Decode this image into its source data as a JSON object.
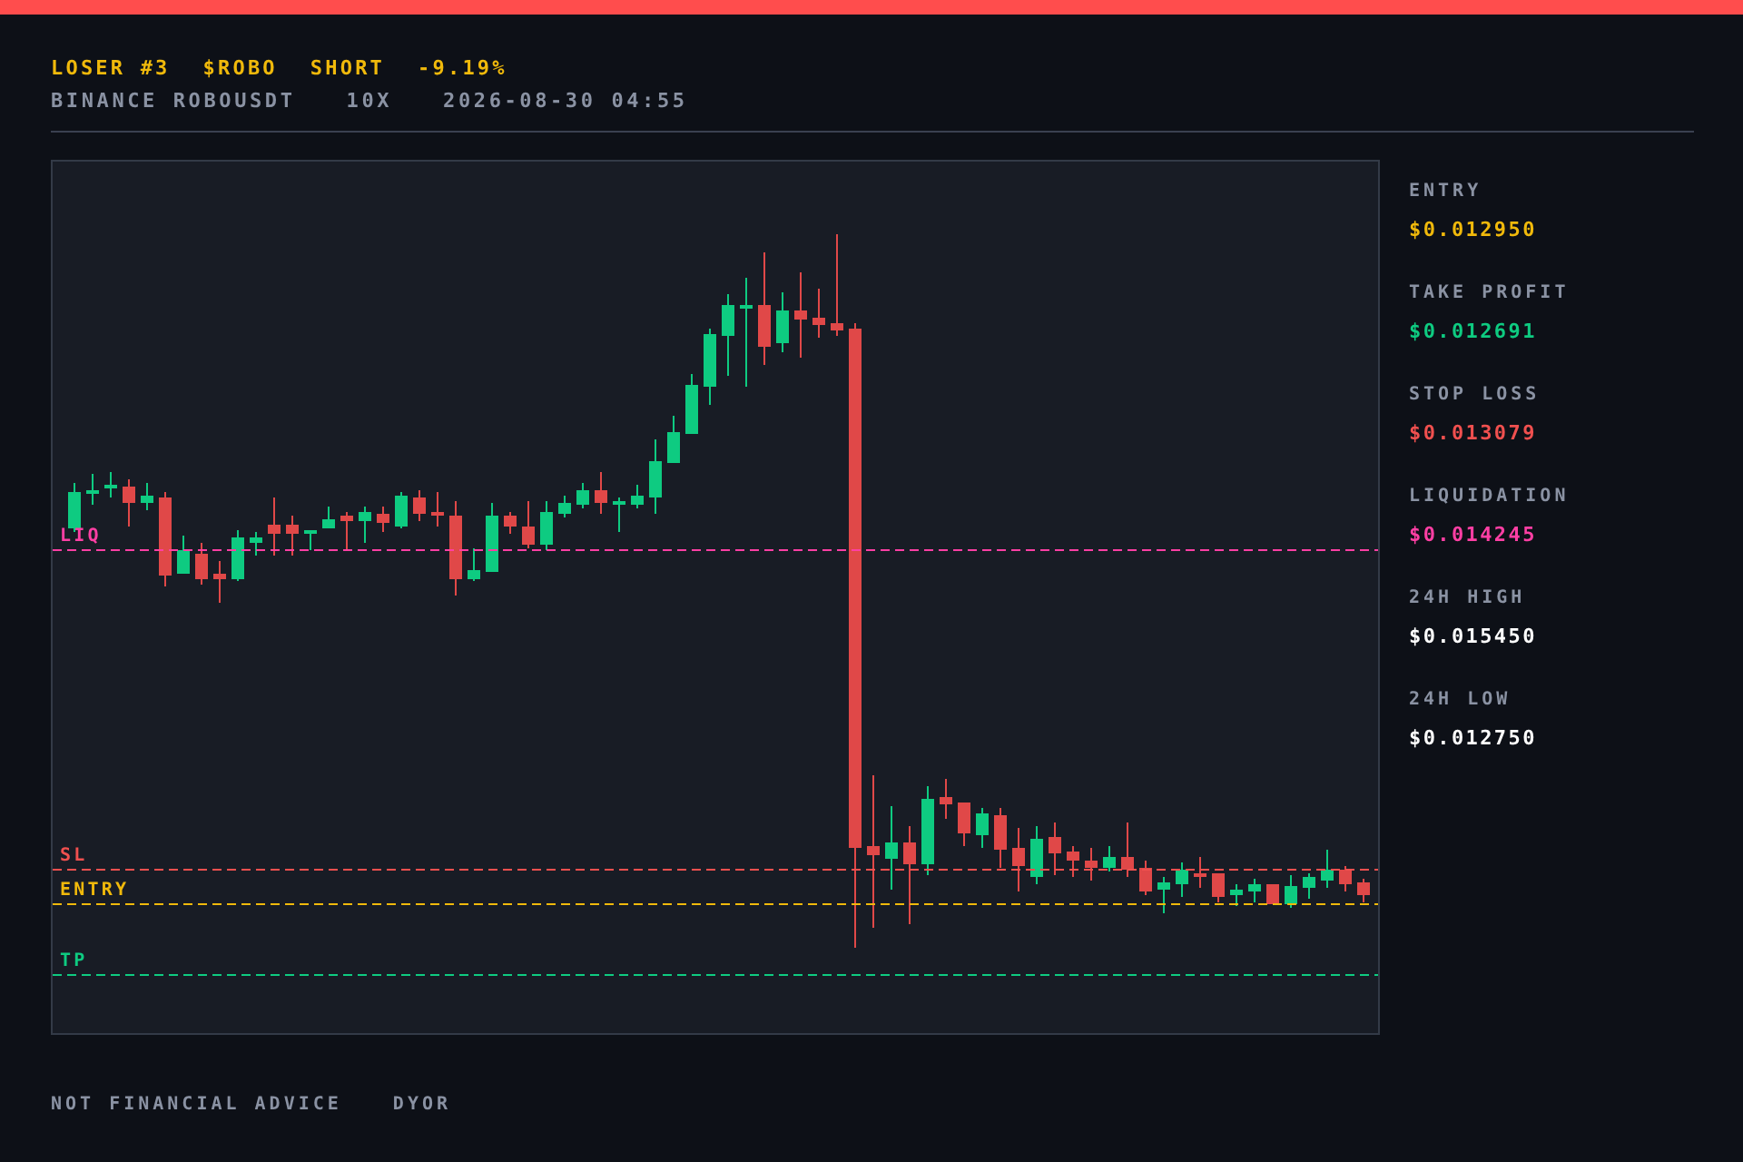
{
  "header": {
    "title_parts": [
      {
        "text": "LOSER #3"
      },
      {
        "text": "$ROBO"
      },
      {
        "text": "SHORT"
      },
      {
        "text": "-9.19%"
      }
    ],
    "subtitle_parts": [
      "BINANCE ROBOUSDT",
      "10X",
      "2026-08-30 04:55"
    ]
  },
  "chart": {
    "levels": [
      {
        "label": "LIQ",
        "color": "#ff3fa4"
      },
      {
        "label": "SL",
        "color": "#f0504f"
      },
      {
        "label": "ENTRY",
        "color": "#f0b90b"
      },
      {
        "label": "TP",
        "color": "#0ecb81"
      }
    ]
  },
  "stats": [
    {
      "label": "ENTRY",
      "value": "$0.012950",
      "color": "#f0b90b"
    },
    {
      "label": "TAKE PROFIT",
      "value": "$0.012691",
      "color": "#0ecb81"
    },
    {
      "label": "STOP LOSS",
      "value": "$0.013079",
      "color": "#f0504f"
    },
    {
      "label": "LIQUIDATION",
      "value": "$0.014245",
      "color": "#ff3fa4"
    },
    {
      "label": "24H HIGH",
      "value": "$0.015450",
      "color": "#ffffff"
    },
    {
      "label": "24H LOW",
      "value": "$0.012750",
      "color": "#ffffff"
    }
  ],
  "footer": [
    "NOT FINANCIAL ADVICE",
    "DYOR"
  ]
}
